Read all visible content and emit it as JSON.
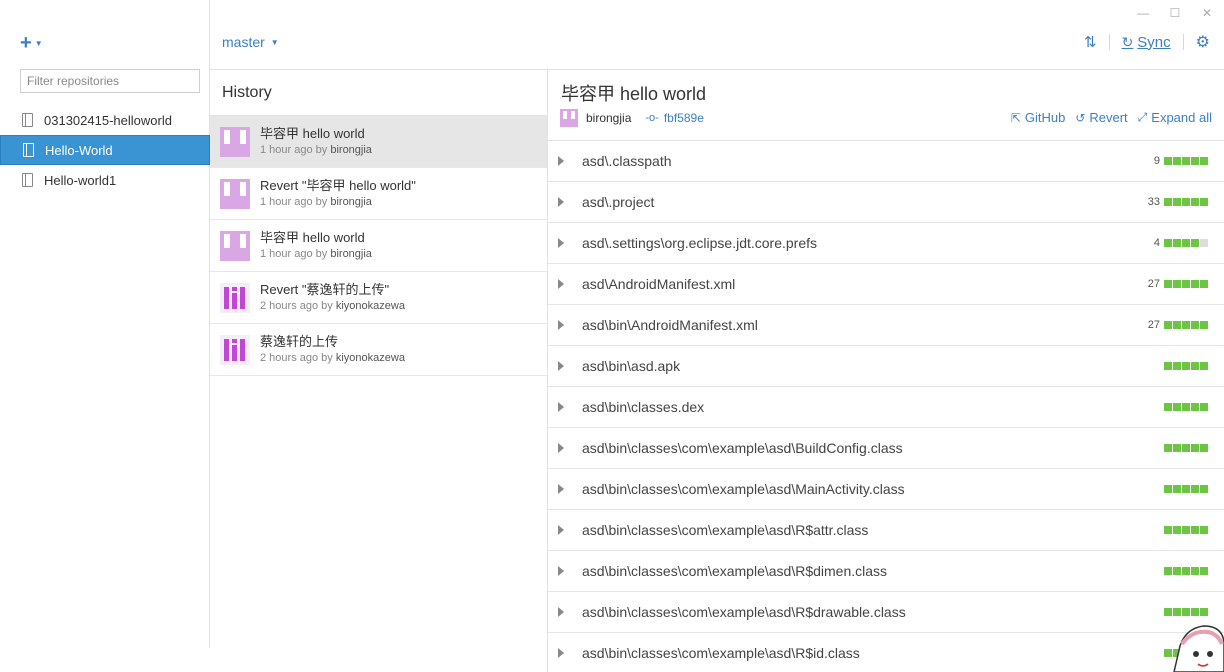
{
  "sidebar": {
    "add_label": "+",
    "filter_placeholder": "Filter repositories",
    "repos": [
      "031302415-helloworld",
      "Hello-World",
      "Hello-world1"
    ]
  },
  "topbar": {
    "branch": "master",
    "sync_label": "Sync"
  },
  "history": {
    "title": "History",
    "commits": [
      {
        "message": "毕容甲 hello world",
        "time": "1 hour ago by",
        "author": "birongjia"
      },
      {
        "message": "Revert \"毕容甲 hello world\"",
        "time": "1 hour ago by",
        "author": "birongjia"
      },
      {
        "message": "毕容甲 hello world",
        "time": "1 hour ago by",
        "author": "birongjia"
      },
      {
        "message": "Revert \"蔡逸轩的上传\"",
        "time": "2 hours ago by",
        "author": "kiyonokazewa"
      },
      {
        "message": "蔡逸轩的上传",
        "time": "2 hours ago by",
        "author": "kiyonokazewa"
      }
    ]
  },
  "detail": {
    "title": "毕容甲 hello world",
    "author": "birongjia",
    "sha": "fbf589e",
    "actions": {
      "github": "GitHub",
      "revert": "Revert",
      "expand": "Expand all"
    },
    "files": [
      {
        "path": "asd\\.classpath",
        "count": "9"
      },
      {
        "path": "asd\\.project",
        "count": "33"
      },
      {
        "path": "asd\\.settings\\org.eclipse.jdt.core.prefs",
        "count": "4"
      },
      {
        "path": "asd\\AndroidManifest.xml",
        "count": "27"
      },
      {
        "path": "asd\\bin\\AndroidManifest.xml",
        "count": "27"
      },
      {
        "path": "asd\\bin\\asd.apk",
        "count": ""
      },
      {
        "path": "asd\\bin\\classes.dex",
        "count": ""
      },
      {
        "path": "asd\\bin\\classes\\com\\example\\asd\\BuildConfig.class",
        "count": ""
      },
      {
        "path": "asd\\bin\\classes\\com\\example\\asd\\MainActivity.class",
        "count": ""
      },
      {
        "path": "asd\\bin\\classes\\com\\example\\asd\\R$attr.class",
        "count": ""
      },
      {
        "path": "asd\\bin\\classes\\com\\example\\asd\\R$dimen.class",
        "count": ""
      },
      {
        "path": "asd\\bin\\classes\\com\\example\\asd\\R$drawable.class",
        "count": ""
      },
      {
        "path": "asd\\bin\\classes\\com\\example\\asd\\R$id.class",
        "count": ""
      }
    ]
  },
  "colors": {
    "accent": "#3b7fc4",
    "selected": "#3a94d4",
    "additions": "#6cc644"
  }
}
